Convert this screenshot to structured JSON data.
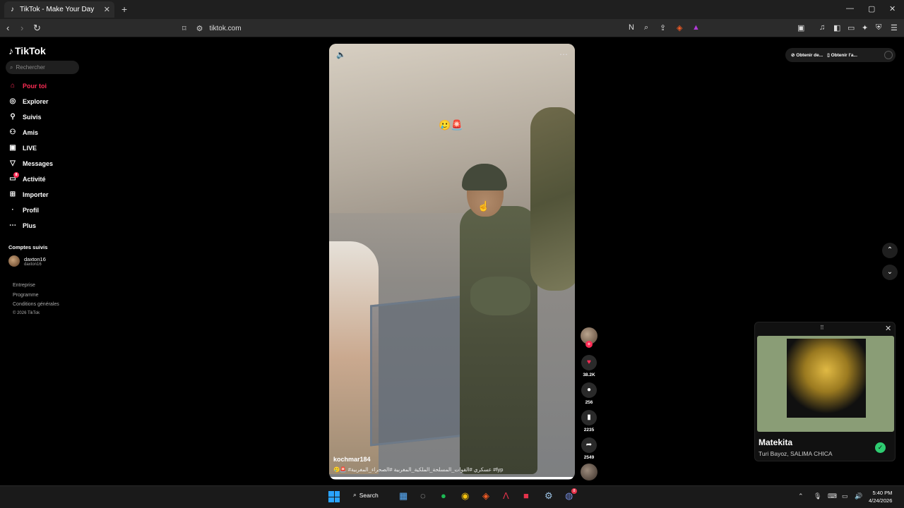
{
  "browser": {
    "tab_title": "TikTok - Make Your Day",
    "tab_icon": "tiktok-icon",
    "new_tab": "+",
    "url": "tiktok.com",
    "window_controls": {
      "minimize": "—",
      "restore": "▢",
      "close": "✕"
    }
  },
  "sidebar": {
    "logo": "TikTok",
    "search_placeholder": "Rechercher",
    "nav": [
      {
        "label": "Pour toi",
        "icon": "home-icon",
        "active": true
      },
      {
        "label": "Explorer",
        "icon": "compass-icon"
      },
      {
        "label": "Suivis",
        "icon": "following-icon"
      },
      {
        "label": "Amis",
        "icon": "friends-icon"
      },
      {
        "label": "LIVE",
        "icon": "live-icon"
      },
      {
        "label": "Messages",
        "icon": "messages-icon"
      },
      {
        "label": "Activité",
        "icon": "activity-icon",
        "badge": "8"
      },
      {
        "label": "Importer",
        "icon": "upload-icon"
      },
      {
        "label": "Profil",
        "icon": "profile-icon"
      },
      {
        "label": "Plus",
        "icon": "more-icon"
      }
    ],
    "following_heading": "Comptes suivis",
    "following": [
      {
        "name": "daxton16",
        "handle": "daxton16"
      }
    ],
    "footer": [
      "Entreprise",
      "Programme",
      "Conditions générales",
      "© 2026 TikTok"
    ]
  },
  "video": {
    "username": "kochmar184",
    "caption": "🥲🚨 #عسكري #القوات_المسلحة_الملكية_المغربية #الصحراء_المغربية #fyp",
    "emoji_overlay": "🥲🚨",
    "progress": 0.99
  },
  "actions": {
    "likes": "38.2K",
    "comments": "256",
    "saves": "2235",
    "shares": "2549"
  },
  "top_right": {
    "get_desktop": "Obtenir de...",
    "get_app": "Obtenir l'a..."
  },
  "mini_player": {
    "title": "Matekita",
    "artist": "Turi Bayoz, SALIMA CHICA"
  },
  "taskbar": {
    "search_label": "Search",
    "time": "5:40 PM",
    "date": "4/24/2026",
    "discord_badge": "8"
  },
  "colors": {
    "accent": "#fe2c55",
    "verified": "#2ecc71"
  }
}
